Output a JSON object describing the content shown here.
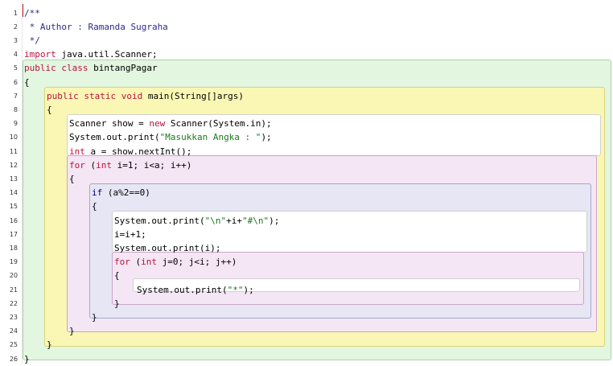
{
  "editor": {
    "line_numbers": [
      "1",
      "2",
      "3",
      "4",
      "5",
      "6",
      "7",
      "8",
      "9",
      "10",
      "11",
      "12",
      "13",
      "14",
      "15",
      "16",
      "17",
      "18",
      "19",
      "20",
      "21",
      "22",
      "23",
      "24",
      "25",
      "26"
    ],
    "lines": [
      [
        {
          "t": "/**",
          "c": "cm"
        }
      ],
      [
        {
          "t": " * Author : Ramanda Sugraha",
          "c": "cm"
        }
      ],
      [
        {
          "t": " */",
          "c": "cm"
        }
      ],
      [
        {
          "t": "import",
          "c": "kw"
        },
        {
          "t": " java.util.Scanner;",
          "c": ""
        }
      ],
      [
        {
          "t": "public class",
          "c": "kw"
        },
        {
          "t": " bintangPagar",
          "c": ""
        }
      ],
      [
        {
          "t": "{",
          "c": ""
        }
      ],
      [
        {
          "t": "public static void",
          "c": "kw"
        },
        {
          "t": " main(String[]args)",
          "c": ""
        }
      ],
      [
        {
          "t": "{",
          "c": ""
        }
      ],
      [
        {
          "t": "Scanner show = ",
          "c": ""
        },
        {
          "t": "new",
          "c": "kw"
        },
        {
          "t": " Scanner(System.in);",
          "c": ""
        }
      ],
      [
        {
          "t": "System.out.print(",
          "c": ""
        },
        {
          "t": "\"Masukkan Angka : \"",
          "c": "str"
        },
        {
          "t": ");",
          "c": ""
        }
      ],
      [
        {
          "t": "int",
          "c": "kw"
        },
        {
          "t": " a = show.nextInt();",
          "c": ""
        }
      ],
      [
        {
          "t": "for",
          "c": "kw"
        },
        {
          "t": " (",
          "c": ""
        },
        {
          "t": "int",
          "c": "kw"
        },
        {
          "t": " i=1; i<a; i++)",
          "c": ""
        }
      ],
      [
        {
          "t": "{",
          "c": ""
        }
      ],
      [
        {
          "t": "if",
          "c": "kw2"
        },
        {
          "t": " (a%2==0)",
          "c": ""
        }
      ],
      [
        {
          "t": "{",
          "c": ""
        }
      ],
      [
        {
          "t": "System.out.print(",
          "c": ""
        },
        {
          "t": "\"\\n\"",
          "c": "str"
        },
        {
          "t": "+i+",
          "c": ""
        },
        {
          "t": "\"#\\n\"",
          "c": "str"
        },
        {
          "t": ");",
          "c": ""
        }
      ],
      [
        {
          "t": "i=i+1;",
          "c": ""
        }
      ],
      [
        {
          "t": "System.out.print(i);",
          "c": ""
        }
      ],
      [
        {
          "t": "for",
          "c": "kw"
        },
        {
          "t": " (",
          "c": ""
        },
        {
          "t": "int",
          "c": "kw"
        },
        {
          "t": " j=0; j<i; j++)",
          "c": ""
        }
      ],
      [
        {
          "t": "{",
          "c": ""
        }
      ],
      [
        {
          "t": "System.out.print(",
          "c": ""
        },
        {
          "t": "\"*\"",
          "c": "str"
        },
        {
          "t": ");",
          "c": ""
        }
      ],
      [
        {
          "t": "}",
          "c": ""
        }
      ],
      [
        {
          "t": "}",
          "c": ""
        }
      ],
      [
        {
          "t": "}",
          "c": ""
        }
      ],
      [
        {
          "t": "}",
          "c": ""
        }
      ],
      [
        {
          "t": "}",
          "c": ""
        }
      ]
    ]
  },
  "colors": {
    "class_scope_bg": "#e2f6e0",
    "class_scope_border": "#a9d6a6",
    "method_scope_bg": "#faf7b4",
    "method_scope_border": "#d8d37c",
    "for_scope_bg": "#f4e6f4",
    "for_scope_border": "#c9a6c9",
    "if_scope_bg": "#e6e6f4",
    "if_scope_border": "#a8a8c8",
    "inner_block_bg": "#ffffff",
    "inner_block_border": "#d0d0d0",
    "keyword": "#b7143e",
    "string": "#1a7a1a",
    "comment": "#2a2a8a",
    "caret": "#c8141e"
  }
}
